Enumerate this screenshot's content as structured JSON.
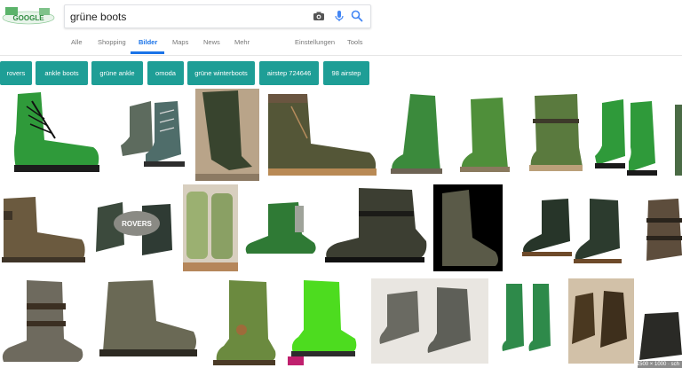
{
  "search": {
    "query": "grüne boots"
  },
  "tabs": [
    {
      "label": "Alle"
    },
    {
      "label": "Shopping"
    },
    {
      "label": "Bilder",
      "active": true
    },
    {
      "label": "Maps"
    },
    {
      "label": "News"
    },
    {
      "label": "Mehr"
    },
    {
      "label": "Einstellungen"
    },
    {
      "label": "Tools"
    }
  ],
  "chips": [
    "rovers",
    "ankle boots",
    "grüne ankle",
    "omoda",
    "grüne winterboots",
    "airstep 724646",
    "98 airstep"
  ],
  "caption": "1500 × 1000 · sch",
  "colors": {
    "accent": "#1a73e8",
    "chip": "#1e9e96",
    "boot_green": "#2f9a3a",
    "boot_olive": "#5a5a3c",
    "boot_brown": "#6b5a3f",
    "neon_green": "#4ddc1f"
  }
}
